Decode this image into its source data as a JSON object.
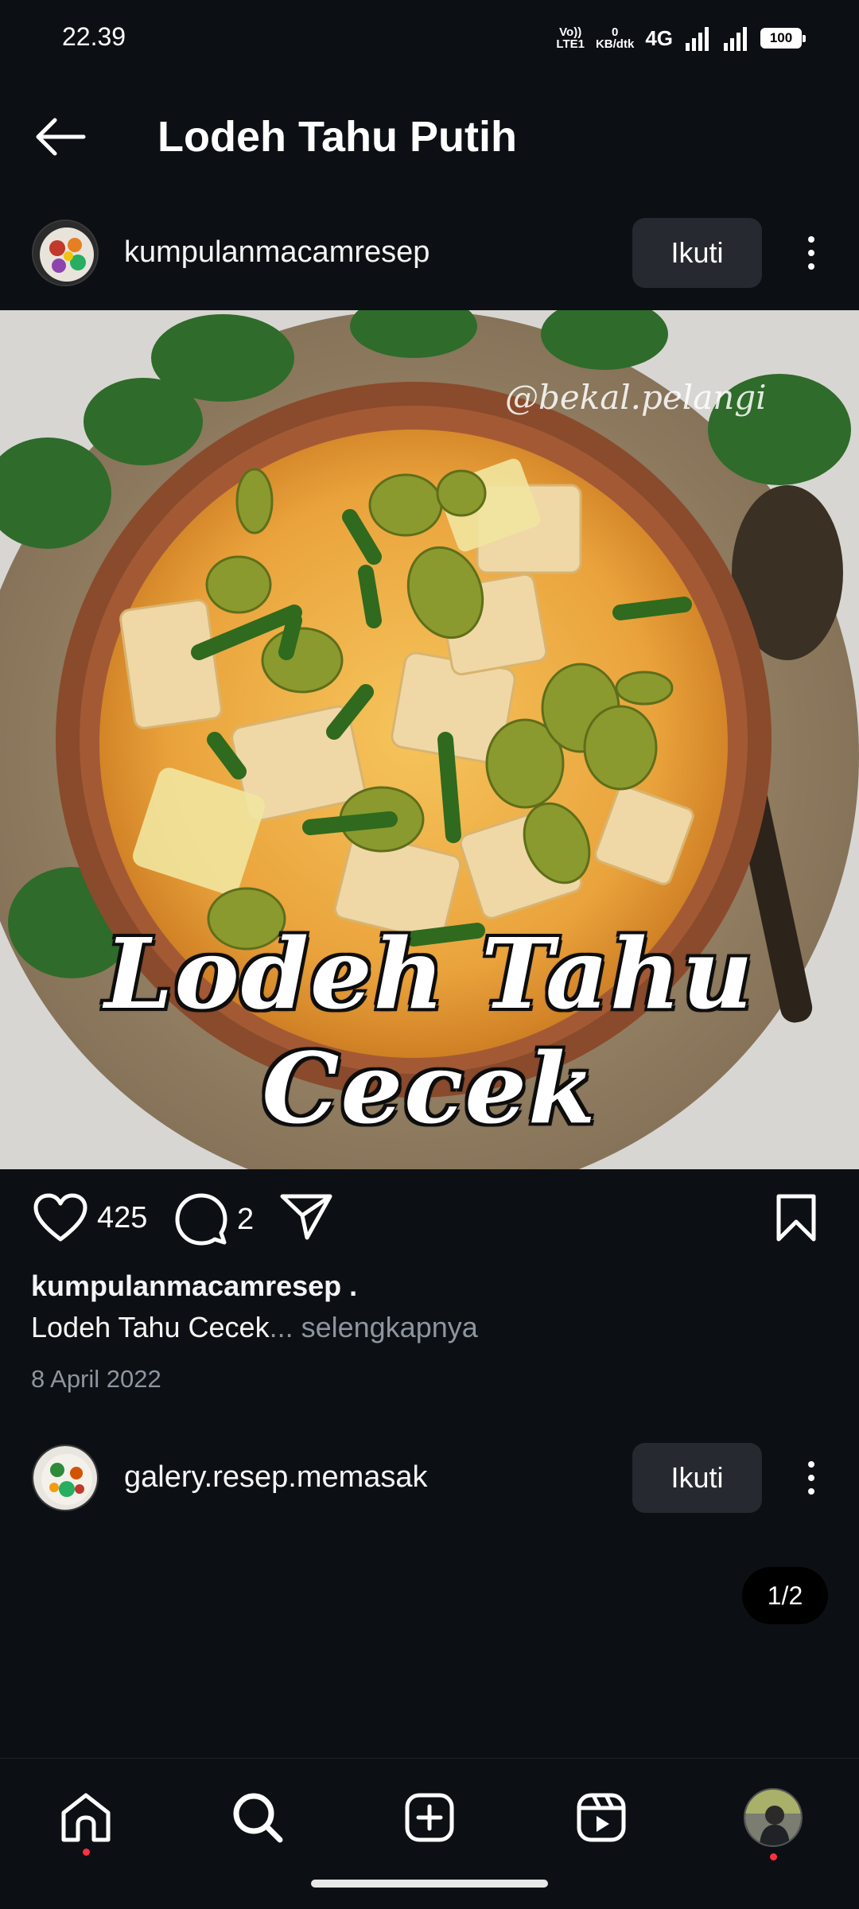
{
  "status_bar": {
    "time": "22.39",
    "volte_top": "Vo))",
    "volte_bottom": "LTE1",
    "speed_top": "0",
    "speed_bottom": "KB/dtk",
    "network": "4G",
    "battery": "100"
  },
  "header": {
    "title": "Lodeh Tahu Putih"
  },
  "post": {
    "author": "kumpulanmacamresep",
    "follow_label": "Ikuti",
    "image_overlay_text": "Lodeh Tahu Cecek",
    "image_watermark": "@bekal.pelangi",
    "likes": "425",
    "comments": "2",
    "caption_user": "kumpulanmacamresep .",
    "caption_text": "Lodeh Tahu Cecek",
    "caption_more": "... selengkapnya",
    "date": "8 April 2022"
  },
  "next_post": {
    "author": "galery.resep.memasak",
    "follow_label": "Ikuti"
  },
  "pager": {
    "label": "1/2"
  },
  "bottom_nav": {
    "items": [
      "home-icon",
      "search-icon",
      "create-icon",
      "reels-icon",
      "profile-avatar"
    ],
    "notification_color": "#ff3040"
  },
  "colors": {
    "background": "#0c1014",
    "button_bg": "#262a30",
    "muted_text": "#8e959e"
  }
}
